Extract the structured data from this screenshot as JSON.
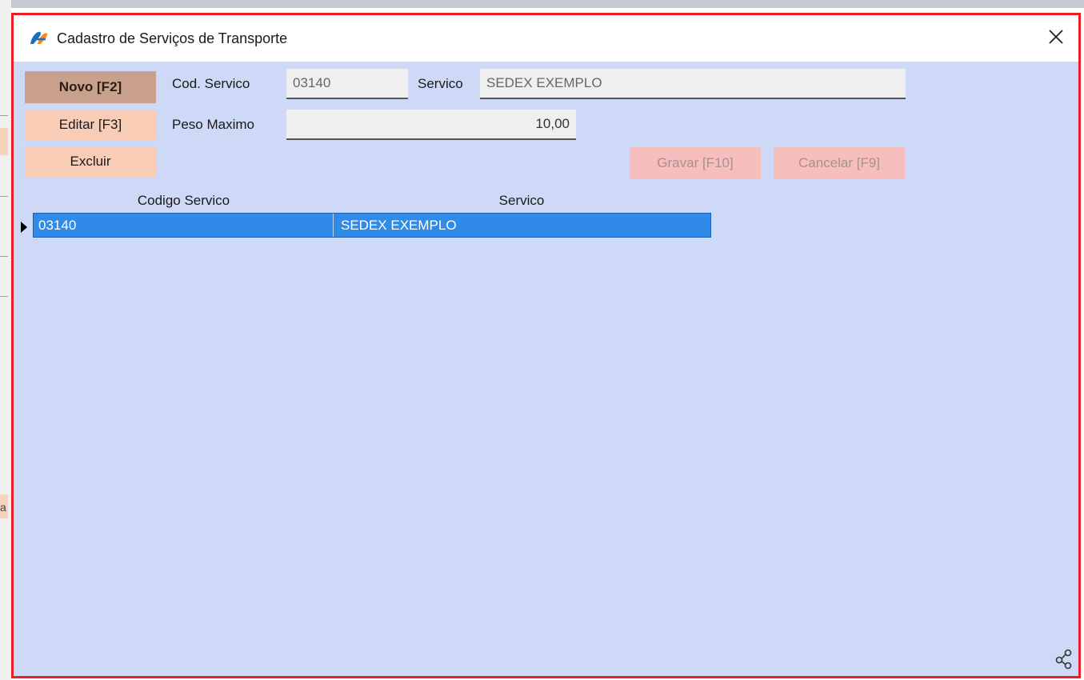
{
  "window": {
    "title": "Cadastro de Serviços de Transporte"
  },
  "actions": {
    "novo": "Novo [F2]",
    "editar": "Editar [F3]",
    "excluir": "Excluir",
    "gravar": "Gravar [F10]",
    "cancelar": "Cancelar [F9]"
  },
  "form": {
    "cod_label": "Cod. Servico",
    "cod_value": "03140",
    "servico_label": "Servico",
    "servico_value": "SEDEX EXEMPLO",
    "peso_label": "Peso Maximo",
    "peso_value": "10,00"
  },
  "grid": {
    "columns": [
      "Codigo Servico",
      "Servico"
    ],
    "rows": [
      {
        "codigo": "03140",
        "servico": "SEDEX EXEMPLO"
      }
    ]
  },
  "background": {
    "letter": "a"
  },
  "colors": {
    "window_border": "#ee1c25",
    "window_bg": "#ced9f8",
    "primary_button": "#c8a08c",
    "secondary_button": "#f9cdb5",
    "disabled_button": "#f7bebe",
    "selected_row": "#2f8ae8"
  },
  "icons": {
    "app": "app-logo-icon",
    "close": "close-icon",
    "share": "share-icon",
    "row_indicator": "row-indicator-icon"
  }
}
